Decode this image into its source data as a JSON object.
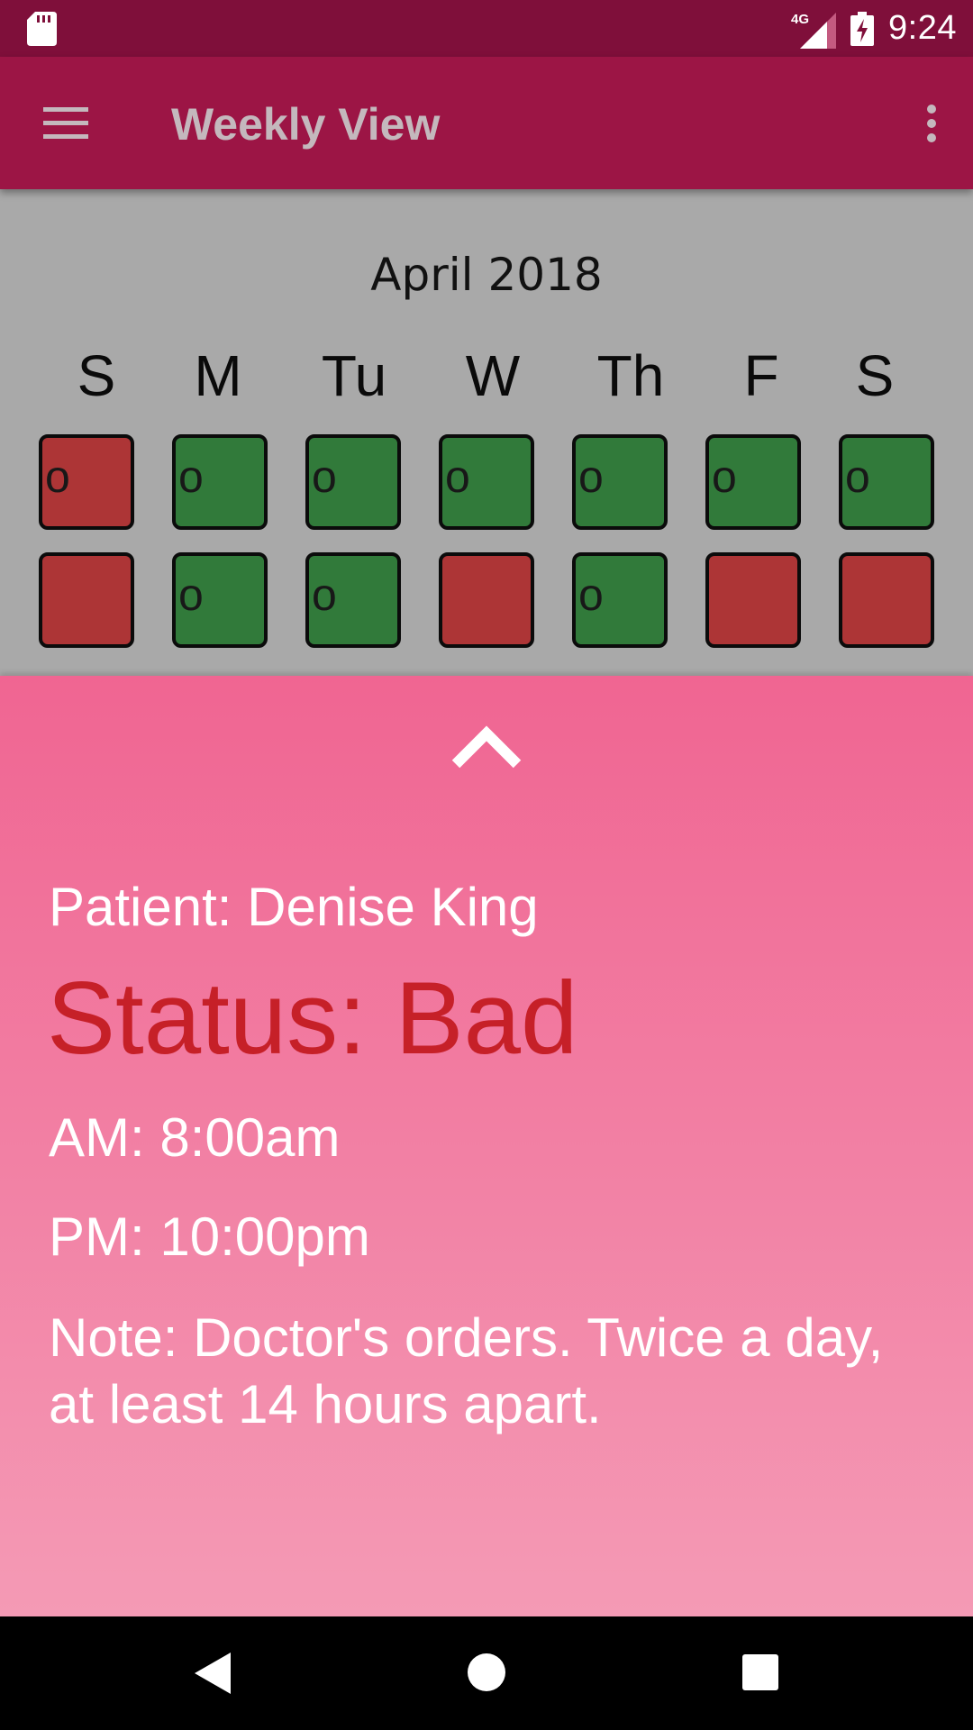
{
  "status_bar": {
    "time": "9:24",
    "network": "4G",
    "icons": [
      "sd-card-icon",
      "signal-icon",
      "battery-charging-icon"
    ]
  },
  "app_bar": {
    "title": "Weekly View",
    "icons": [
      "menu-icon",
      "overflow-menu-icon"
    ]
  },
  "calendar": {
    "month": "April 2018",
    "day_headers": [
      "S",
      "M",
      "Tu",
      "W",
      "Th",
      "F",
      "S"
    ],
    "weeks": [
      [
        {
          "status": "bad",
          "mark": "o"
        },
        {
          "status": "good",
          "mark": "o"
        },
        {
          "status": "good",
          "mark": "o"
        },
        {
          "status": "good",
          "mark": "o"
        },
        {
          "status": "good",
          "mark": "o"
        },
        {
          "status": "good",
          "mark": "o"
        },
        {
          "status": "good",
          "mark": "o"
        }
      ],
      [
        {
          "status": "bad",
          "mark": ""
        },
        {
          "status": "good",
          "mark": "o"
        },
        {
          "status": "good",
          "mark": "o"
        },
        {
          "status": "bad",
          "mark": ""
        },
        {
          "status": "good",
          "mark": "o"
        },
        {
          "status": "bad",
          "mark": ""
        },
        {
          "status": "bad",
          "mark": ""
        }
      ]
    ],
    "colors": {
      "good": "#317a3a",
      "bad": "#ad3536"
    }
  },
  "details": {
    "patient": "Patient: Denise King",
    "status": "Status: Bad",
    "am": "AM: 8:00am",
    "pm": "PM: 10:00pm",
    "note": "Note: Doctor's orders. Twice a day, at least 14 hours apart.",
    "status_color": "#c62028"
  },
  "colors": {
    "status_bar": "#7f0f3a",
    "app_bar": "#9c1545",
    "sheet_top": "#f06592",
    "sheet_bottom": "#f49ab5"
  },
  "nav_bar": {
    "icons": [
      "back-icon",
      "home-icon",
      "recents-icon"
    ]
  }
}
